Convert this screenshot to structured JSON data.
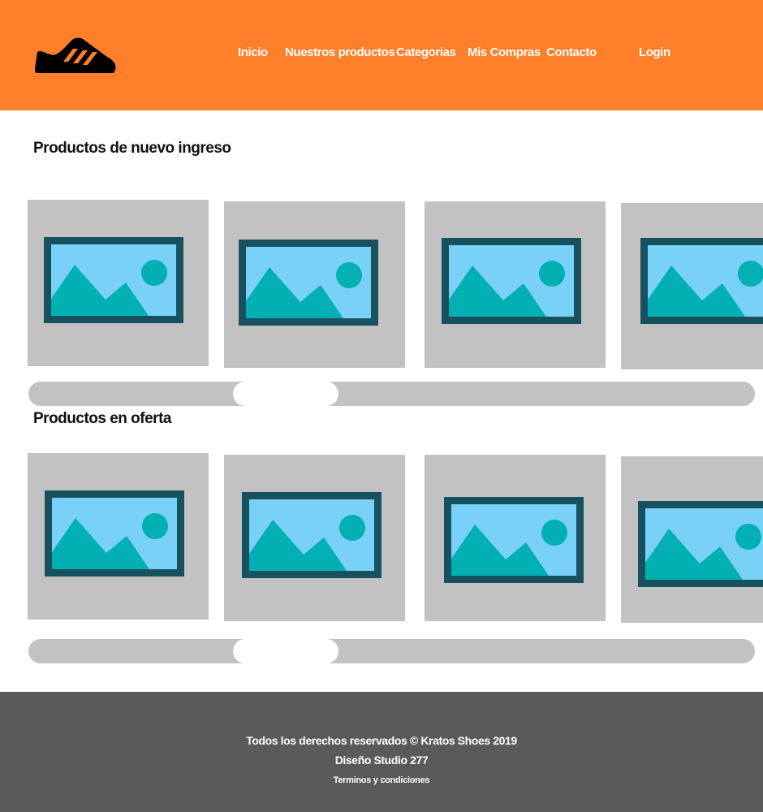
{
  "header": {
    "brand_color": "#ff7f2a",
    "logo_icon": "sneaker-icon",
    "nav": [
      {
        "label": "Inicio"
      },
      {
        "label": "Nuestros productos"
      },
      {
        "label": "Categorias"
      },
      {
        "label": "Mis Compras"
      },
      {
        "label": "Contacto"
      },
      {
        "label": "Login"
      }
    ]
  },
  "sections": [
    {
      "title": "Productos de nuevo ingreso",
      "products": [
        {
          "image": "image-placeholder-icon"
        },
        {
          "image": "image-placeholder-icon"
        },
        {
          "image": "image-placeholder-icon"
        },
        {
          "image": "image-placeholder-icon"
        }
      ]
    },
    {
      "title": "Productos en oferta",
      "products": [
        {
          "image": "image-placeholder-icon"
        },
        {
          "image": "image-placeholder-icon"
        },
        {
          "image": "image-placeholder-icon"
        },
        {
          "image": "image-placeholder-icon"
        }
      ]
    }
  ],
  "footer": {
    "copyright": "Todos los derechos reservados © Kratos Shoes 2019",
    "credit": "Diseño Studio 277",
    "terms_link": "Terminos y condiciones",
    "background_color": "#5a5a5a"
  }
}
